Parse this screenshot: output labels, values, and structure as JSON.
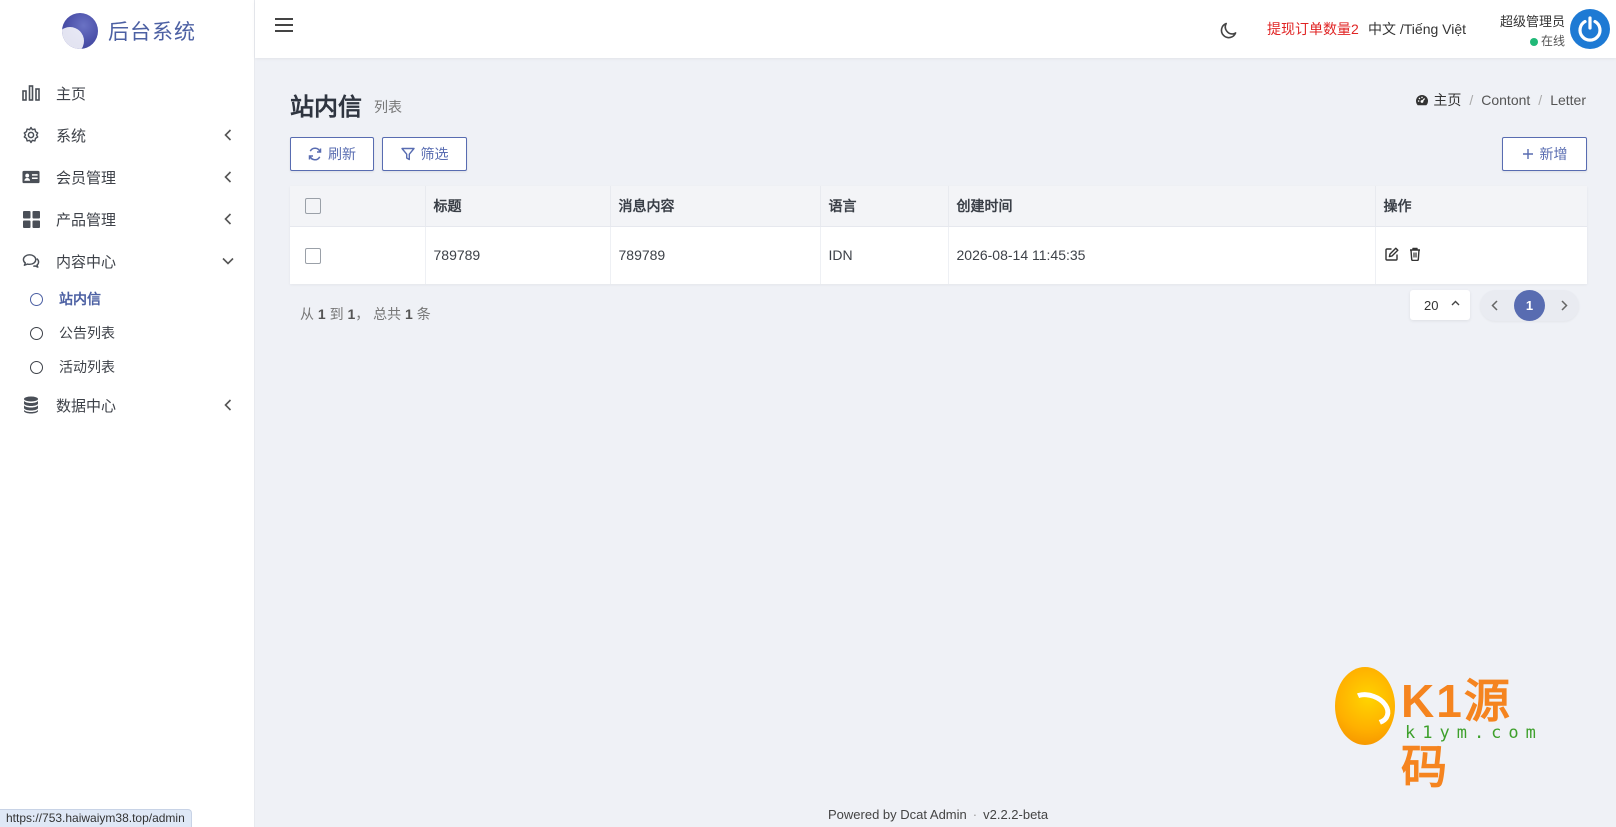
{
  "brand": {
    "title": "后台系统"
  },
  "sidebar": {
    "items": [
      {
        "label": "主页",
        "icon": "bar-chart-icon",
        "expandable": false
      },
      {
        "label": "系统",
        "icon": "gear-icon",
        "expandable": true
      },
      {
        "label": "会员管理",
        "icon": "id-card-icon",
        "expandable": true
      },
      {
        "label": "产品管理",
        "icon": "grid-icon",
        "expandable": true
      },
      {
        "label": "内容中心",
        "icon": "chat-icon",
        "expandable": true,
        "expanded": true,
        "children": [
          {
            "label": "站内信",
            "active": true
          },
          {
            "label": "公告列表"
          },
          {
            "label": "活动列表"
          }
        ]
      },
      {
        "label": "数据中心",
        "icon": "database-icon",
        "expandable": true
      }
    ]
  },
  "header": {
    "orders_alert": "提现订单数量2",
    "language": "中文 /Tiếng Việt",
    "user_name": "超级管理员",
    "user_status": "在线",
    "status_color": "#21b978"
  },
  "page": {
    "title": "站内信",
    "subtitle": "列表",
    "breadcrumb": [
      "主页",
      "Contont",
      "Letter"
    ]
  },
  "toolbar": {
    "refresh_label": "刷新",
    "filter_label": "筛选",
    "new_label": "新增"
  },
  "table": {
    "columns": [
      "标题",
      "消息内容",
      "语言",
      "创建时间",
      "操作"
    ],
    "rows": [
      {
        "title": "789789",
        "content": "789789",
        "language": "IDN",
        "created_at": "2026-08-14 11:45:35"
      }
    ]
  },
  "pagination": {
    "from": "1",
    "to": "1",
    "total": "1",
    "text_from": "从",
    "text_to": "到",
    "text_total": "， 总共",
    "text_unit": "条",
    "per_page": "20",
    "current_page": "1"
  },
  "footer": {
    "powered_by": "Powered by",
    "product": "Dcat Admin",
    "version": "v2.2.2-beta"
  },
  "watermark": {
    "brand_k1": "K1",
    "brand_cn": "源码",
    "url": "k1ym.com"
  },
  "statusbar": {
    "url": "https://753.haiwaiym38.top/admin"
  },
  "colors": {
    "primary": "#586cb1",
    "alert": "#e02424"
  }
}
